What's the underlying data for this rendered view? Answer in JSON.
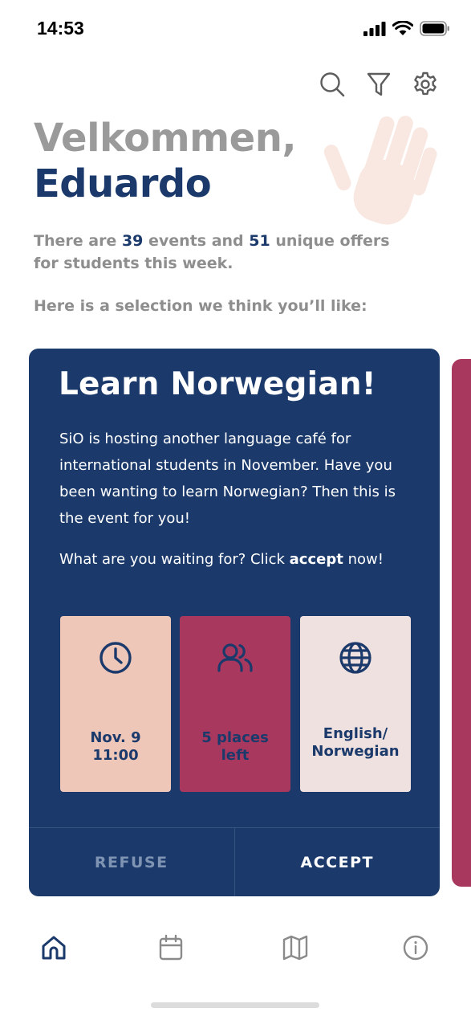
{
  "status_bar": {
    "time": "14:53"
  },
  "toolbar": {
    "icons": [
      "search-icon",
      "filter-icon",
      "settings-icon"
    ]
  },
  "greeting": {
    "line1": "Velkommen,",
    "name": "Eduardo"
  },
  "summary": {
    "prefix": "There are ",
    "events_count": "39",
    "middle": " events and ",
    "offers_count": "51",
    "suffix": " unique offers for students this week."
  },
  "selection_hint": "Here is a selection we think you’ll like:",
  "card": {
    "title": "Learn Norwegian!",
    "body": "SiO is hosting another language café for international students in November. Have you been wanting to learn Norwegian? Then this is the event for you!",
    "cta_prefix": "What are you waiting for? Click ",
    "cta_bold": "accept",
    "cta_suffix": " now!",
    "tiles": {
      "time": {
        "line1": "Nov. 9",
        "line2": "11:00",
        "icon": "clock-icon"
      },
      "places": {
        "line1": "5 places",
        "line2": "left",
        "icon": "people-icon"
      },
      "language": {
        "line1": "English/",
        "line2": "Norwegian",
        "icon": "globe-icon"
      }
    },
    "refuse_label": "REFUSE",
    "accept_label": "ACCEPT"
  },
  "tab_bar": {
    "icons": [
      "home-icon",
      "calendar-icon",
      "map-icon",
      "info-icon"
    ],
    "active": "home-icon"
  },
  "colors": {
    "navy": "#1b3a6b",
    "raspberry": "#a8385e",
    "peach": "#efc7b8",
    "blush": "#efe1df",
    "grey_text": "#8e8e8e"
  }
}
